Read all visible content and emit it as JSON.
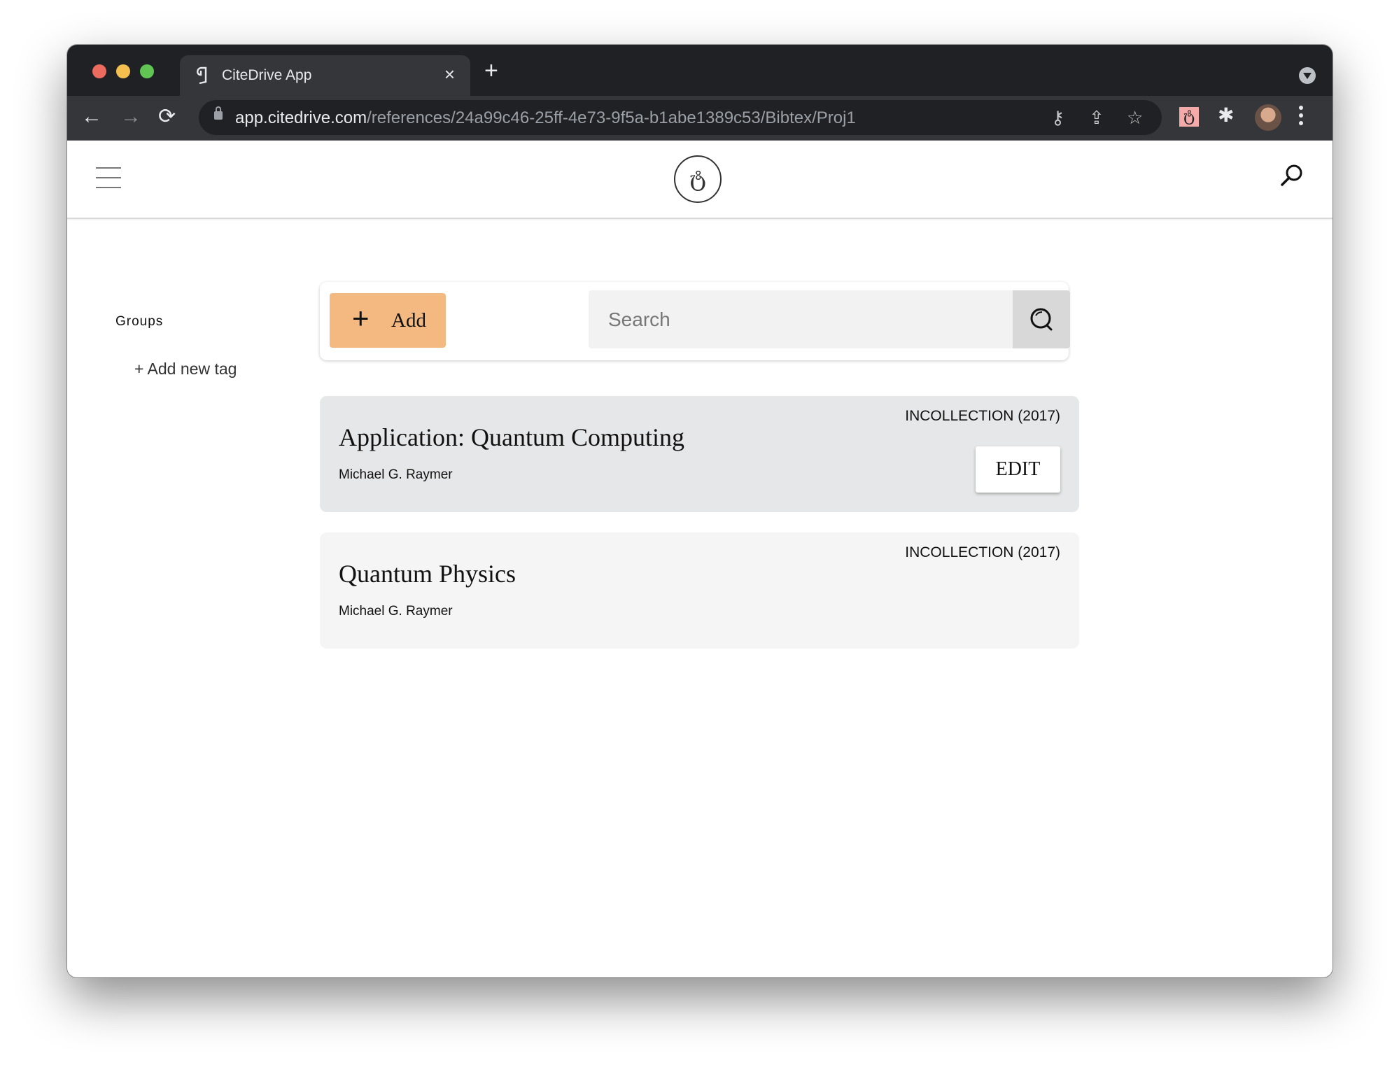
{
  "browser": {
    "tab": {
      "title": "CiteDrive App",
      "favicon": "citedrive-logo-icon",
      "close": "×"
    },
    "new_tab": "+",
    "url_host": "app.citedrive.com",
    "url_path": "/references/24a99c46-25ff-4e73-9f5a-b1abe1389c53/Bibtex/Proj1",
    "nav": {
      "back": "←",
      "forward": "→",
      "reload": "⟳"
    },
    "omnibox_icons": {
      "key": "⚷",
      "share": "⇪",
      "star": "☆"
    },
    "extensions": {
      "citedrive": "ტ",
      "puzzle": "✱"
    }
  },
  "app": {
    "logo": "ტ",
    "sidebar": {
      "groups_label": "Groups",
      "add_tag_label": "+ Add new tag"
    },
    "toolbar": {
      "add_label": "Add",
      "add_icon": "+",
      "search_placeholder": "Search"
    },
    "references": [
      {
        "type": "INCOLLECTION (2017)",
        "title": "Application: Quantum Computing",
        "author": "Michael G. Raymer",
        "edit_label": "EDIT"
      },
      {
        "type": "INCOLLECTION (2017)",
        "title": "Quantum Physics",
        "author": "Michael G. Raymer"
      }
    ]
  }
}
